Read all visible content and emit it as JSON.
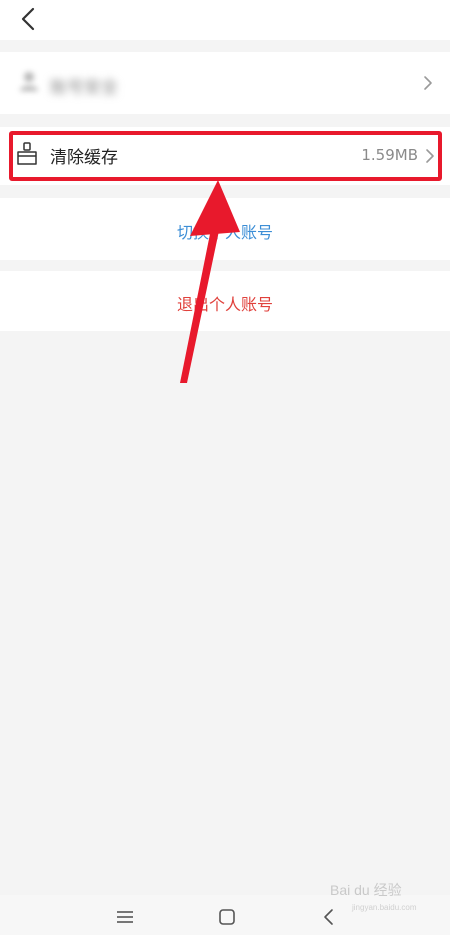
{
  "header": {
    "back_icon": "chevron-left-icon"
  },
  "settings": {
    "blurred_item": {
      "icon": "person-icon",
      "label": "账号安全"
    },
    "clear_cache": {
      "icon": "broom-icon",
      "label": "清除缓存",
      "size": "1.59MB"
    },
    "switch_account": {
      "label": "切换个人账号",
      "color": "#3c8ed6"
    },
    "logout": {
      "label": "退出个人账号",
      "color": "#e0413c"
    }
  },
  "annotation": {
    "highlight_color": "#e8192c"
  },
  "navbar": {
    "icons": [
      "menu-icon",
      "home-icon",
      "back-icon"
    ]
  },
  "watermark": {
    "text": "Bai du 经验",
    "subtext": "jingyan.baidu.com"
  }
}
